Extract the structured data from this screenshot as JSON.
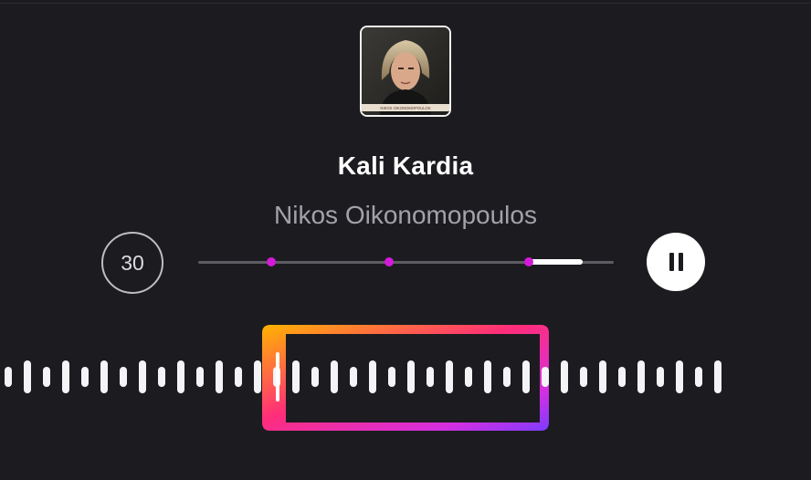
{
  "player": {
    "song_title": "Kali Kardia",
    "artist": "Nikos Oikonomopoulos",
    "skip_seconds": "30",
    "album_caption": "NIKOS OIKONOMOPOULOS"
  },
  "progress": {
    "position_fraction": 0.8,
    "played_fraction": 0.92
  },
  "markers": [
    0.175,
    0.46,
    0.79
  ],
  "waveform": {
    "bar_count": 38,
    "selected_range": [
      14,
      27
    ]
  },
  "colors": {
    "background": "#1c1c20",
    "marker": "#d21ad8",
    "selection_gradient": [
      "#ffb400",
      "#ff2d7a",
      "#c22df0",
      "#7d3cff"
    ]
  },
  "icons": {
    "skip": "skip-30-icon",
    "pause": "pause-icon",
    "artwork": "album-art"
  }
}
